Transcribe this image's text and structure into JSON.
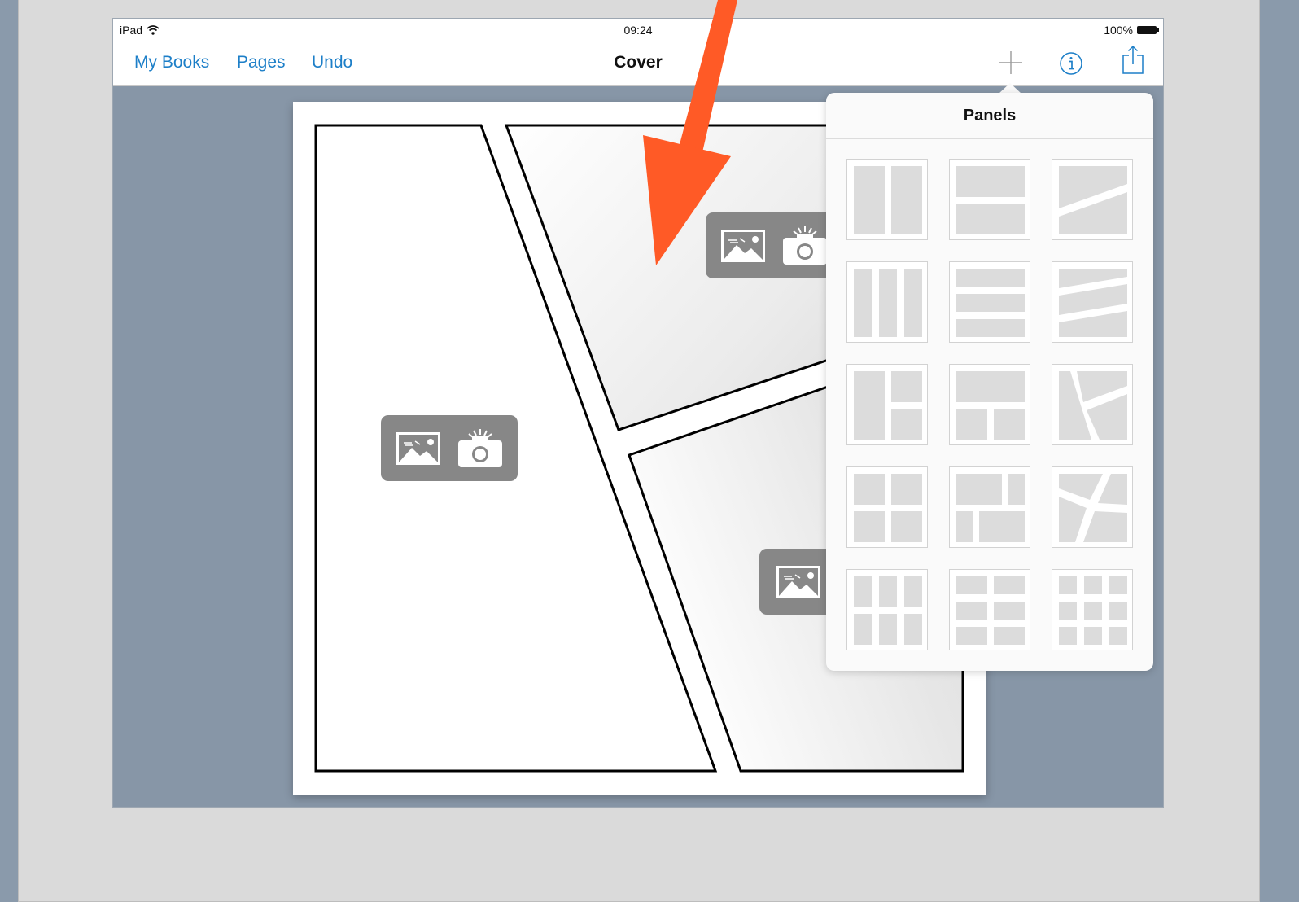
{
  "status_bar": {
    "device": "iPad",
    "time": "09:24",
    "battery": "100%"
  },
  "nav": {
    "left_links": [
      "My Books",
      "Pages",
      "Undo"
    ],
    "title": "Cover",
    "icons": [
      "plus-icon",
      "info-icon",
      "share-icon"
    ]
  },
  "popover": {
    "title": "Panels",
    "layouts": [
      "two-columns",
      "two-rows",
      "two-slanted",
      "three-columns",
      "three-rows",
      "three-slanted",
      "column-plus-two",
      "row-plus-two",
      "three-angled",
      "four-grid",
      "four-mixed",
      "four-angled",
      "six-grid-rows",
      "six-grid-cols",
      "nine-grid"
    ]
  },
  "colors": {
    "accent": "#1d7fc8",
    "annotation_arrow": "#ff5a26",
    "media_button": "#878787",
    "backdrop": "#8796a7"
  }
}
